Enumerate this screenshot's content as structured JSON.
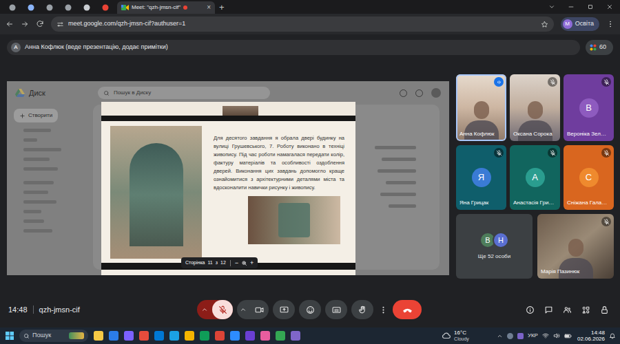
{
  "browser": {
    "tabs": [
      {
        "label": "Meet: \"qzh-jmsn-cif\"",
        "selected": true,
        "close": "×"
      }
    ],
    "new_tab": "+",
    "url": "meet.google.com/qzh-jmsn-cif?authuser=1",
    "profile": {
      "initial": "M",
      "label": "Освіта"
    }
  },
  "meet": {
    "banner": {
      "initial": "А",
      "text": "Анна Кофлюк (веде презентацію, додає примітки)"
    },
    "participants_count": "60",
    "drive": {
      "title": "Диск",
      "search_placeholder": "Пошук в Диску",
      "create": "Створити"
    },
    "slide": {
      "text": "Для десятого завдання я обрала двері будинку на вулиці Грушевського, 7. Роботу виконано в техніці живопису. Під час роботи намагалася передати колір, фактуру матеріалів та особливості оздоблення дверей. Виконання цих завдань допомогло краще ознайомитися з архітектурними деталями міста та вдосконалити навички рисунку і живопису.",
      "page_control": {
        "label": "Сторінка",
        "current": "11",
        "of": "з",
        "total": "12",
        "zoom_out": "−",
        "zoom_in": "+"
      }
    },
    "tiles": [
      {
        "kind": "video",
        "name": "Анна Кофлюк",
        "muted": false,
        "speaking": true
      },
      {
        "kind": "video",
        "name": "Оксана Сорока",
        "muted": true,
        "speaking": false
      },
      {
        "kind": "avatar",
        "name": "Вероніка Зел…",
        "initial": "В",
        "muted": true,
        "speaking": false,
        "color": "#6f3d9e",
        "avatar_color": "#8e5bbf"
      },
      {
        "kind": "avatar",
        "name": "Яна Грицак",
        "initial": "Я",
        "muted": true,
        "speaking": false,
        "color": "#0f5e6b",
        "avatar_color": "#3a7bd5"
      },
      {
        "kind": "avatar",
        "name": "Анастасія Гри…",
        "initial": "А",
        "muted": true,
        "speaking": false,
        "color": "#11655e",
        "avatar_color": "#2a9d8f"
      },
      {
        "kind": "avatar",
        "name": "Сніжана Гала…",
        "initial": "С",
        "muted": true,
        "speaking": false,
        "color": "#d9661f",
        "avatar_color": "#ef8a2e"
      },
      {
        "kind": "more",
        "name": "Ще 52 особи",
        "avatars": [
          {
            "initial": "В",
            "color": "#4e7d5b"
          },
          {
            "initial": "Н",
            "color": "#5a6fd1"
          }
        ]
      },
      {
        "kind": "video",
        "name": "Марія Пазинюк",
        "muted": true,
        "speaking": false
      }
    ],
    "meeting_time": "14:48",
    "meeting_code": "qzh-jmsn-cif",
    "controls": [
      {
        "kind": "mic",
        "muted": true
      },
      {
        "kind": "camera"
      },
      {
        "kind": "present"
      },
      {
        "kind": "emoji"
      },
      {
        "kind": "captions"
      },
      {
        "kind": "hand"
      },
      {
        "kind": "more"
      },
      {
        "kind": "hangup"
      }
    ]
  },
  "taskbar": {
    "search": "Пошук",
    "temperature": "16°C",
    "weather": "Cloudy",
    "language": "УКР",
    "time": "14:48",
    "date": "02.06.2026"
  }
}
